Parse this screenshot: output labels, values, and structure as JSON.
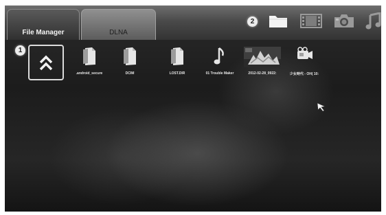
{
  "tabs": [
    {
      "label": "File Manager",
      "active": true
    },
    {
      "label": "DLNA",
      "active": false
    }
  ],
  "callouts": [
    "1",
    "2"
  ],
  "category_icons": [
    "folder-icon",
    "film-icon",
    "camera-icon",
    "music-note-icon"
  ],
  "up_button_icon": "double-chevron-up-icon",
  "items": [
    {
      "label": ".android_secure",
      "icon": "file-icon"
    },
    {
      "label": "DCIM",
      "icon": "file-icon"
    },
    {
      "label": "LOST.DIR",
      "icon": "file-icon"
    },
    {
      "label": "01 Trouble Maker",
      "icon": "music-note-icon"
    },
    {
      "label": "2012-02-28_0922:",
      "icon": "photo-thumbnail"
    },
    {
      "label": "少女時代 - OH( 10:",
      "icon": "video-camera-icon"
    }
  ],
  "colors": {
    "background": "#1f1f1f",
    "topbar": "#4a4a4a",
    "text": "#e6e6e6",
    "badge": "#ececec"
  }
}
